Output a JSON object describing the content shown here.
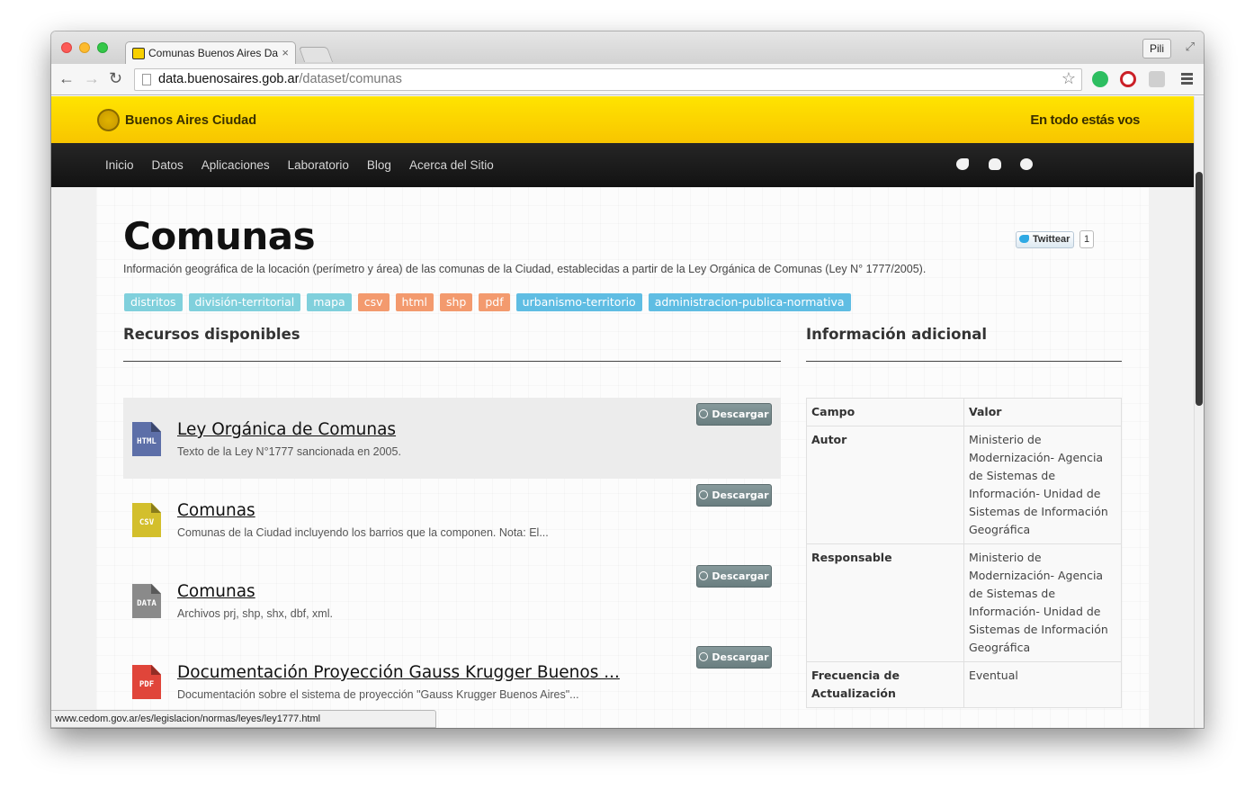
{
  "browser": {
    "tab_title": "Comunas  Buenos Aires Da",
    "user_label": "Pili",
    "url_host": "data.buenosaires.gob.ar",
    "url_path": "/dataset/comunas",
    "status_url": "www.cedom.gov.ar/es/legislacion/normas/leyes/ley1777.html"
  },
  "site": {
    "logo_text": "Buenos Aires Ciudad",
    "slogan": "En todo estás vos",
    "nav": [
      "Inicio",
      "Datos",
      "Aplicaciones",
      "Laboratorio",
      "Blog",
      "Acerca del Sitio"
    ],
    "social_icons": [
      "twitter-icon",
      "github-icon",
      "flickr-icon"
    ]
  },
  "dataset": {
    "title": "Comunas",
    "description": "Información geográfica de la locación (perímetro y área) de las comunas de la Ciudad, establecidas a partir de la Ley Orgánica de Comunas (Ley N° 1777/2005).",
    "tweet_label": "Twittear",
    "tweet_count": "1",
    "tags": [
      {
        "label": "distritos",
        "color": "#80d0dc"
      },
      {
        "label": "división-territorial",
        "color": "#80d0dc"
      },
      {
        "label": "mapa",
        "color": "#80d0dc"
      },
      {
        "label": "csv",
        "color": "#f39a6e"
      },
      {
        "label": "html",
        "color": "#f39a6e"
      },
      {
        "label": "shp",
        "color": "#f39a6e"
      },
      {
        "label": "pdf",
        "color": "#f39a6e"
      },
      {
        "label": "urbanismo-territorio",
        "color": "#5fbde3"
      },
      {
        "label": "administracion-publica-normativa",
        "color": "#5fbde3"
      }
    ]
  },
  "resources": {
    "heading": "Recursos disponibles",
    "download_label": "Descargar",
    "items": [
      {
        "format": "HTML",
        "color": "#5d6fa8",
        "title": "Ley Orgánica de Comunas",
        "description": "Texto de la Ley N°1777 sancionada en 2005."
      },
      {
        "format": "CSV",
        "color": "#d3bf2c",
        "title": "Comunas",
        "description": "Comunas de la Ciudad incluyendo los barrios que la componen. Nota: El..."
      },
      {
        "format": "DATA",
        "color": "#8a8a8a",
        "title": "Comunas",
        "description": "Archivos prj, shp, shx, dbf, xml."
      },
      {
        "format": "PDF",
        "color": "#e0453a",
        "title": "Documentación Proyección Gauss Krugger Buenos ...",
        "description": "Documentación sobre el sistema de proyección \"Gauss Krugger Buenos Aires\"..."
      }
    ]
  },
  "info": {
    "heading": "Información adicional",
    "col_field": "Campo",
    "col_value": "Valor",
    "rows": [
      {
        "field": "Autor",
        "value": "Ministerio de Modernización- Agencia de Sistemas de Información- Unidad de Sistemas de Información Geográfica"
      },
      {
        "field": "Responsable",
        "value": "Ministerio de Modernización- Agencia de Sistemas de Información- Unidad de Sistemas de Información Geográfica"
      },
      {
        "field": "Frecuencia de Actualización",
        "value": "Eventual"
      }
    ]
  }
}
